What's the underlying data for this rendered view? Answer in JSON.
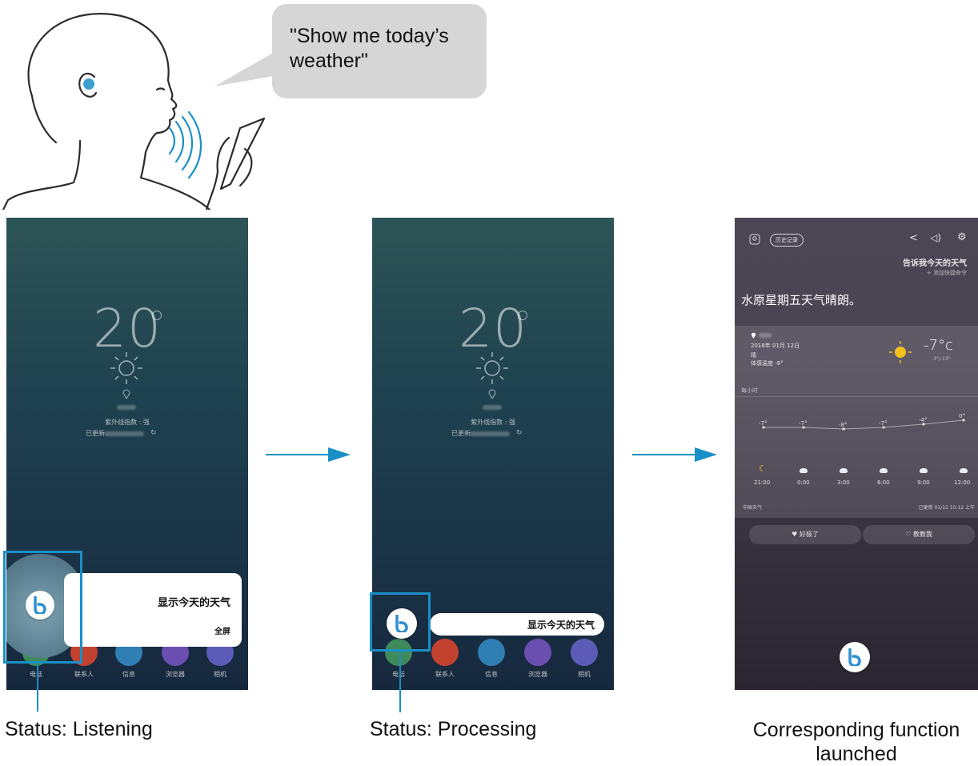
{
  "speech": {
    "text": "\"Show me today’s weather\""
  },
  "phone1": {
    "temperature": "20",
    "uv_index": "紫外线指数 : 强",
    "updated": "已更新",
    "command_text": "显示今天的天气",
    "fullscreen": "全屏",
    "dock": [
      "电话",
      "联系人",
      "信息",
      "浏览器",
      "相机"
    ]
  },
  "phone2": {
    "temperature": "20",
    "uv_index": "紫外线指数 : 强",
    "updated": "已更新",
    "command_text": "显示今天的天气",
    "dock": [
      "电话",
      "联系人",
      "信息",
      "浏览器",
      "相机"
    ]
  },
  "phone3": {
    "history_label": "历史记录",
    "query": "告诉我今天的天气",
    "add_shortcut": "+ 添加快捷命令",
    "response": "水原星期五天气晴朗。",
    "date": "2018年 01月 12日",
    "condition": "晴",
    "feels_like": "体感温度 -8°",
    "current_temp": "-7°c",
    "range": "-3°/-13°",
    "hourly_label": "每小时",
    "forecast_temps": [
      "-7°",
      "-7°",
      "-8°",
      "-7°",
      "-4°",
      "0°"
    ],
    "forecast_times": [
      "21:00",
      "0:00",
      "3:00",
      "6:00",
      "9:00",
      "12:00"
    ],
    "provider": "中国天气",
    "updated_at": "已更新 01/12 10:12 上午",
    "feedback_good": "好极了",
    "feedback_teach": "教教我"
  },
  "captions": {
    "listening": "Status: Listening",
    "processing": "Status: Processing",
    "launched_line1": "Corresponding function",
    "launched_line2": "launched"
  },
  "colors": {
    "highlight": "#1a8fc6",
    "bixby_blue": "#2e8fd0"
  }
}
